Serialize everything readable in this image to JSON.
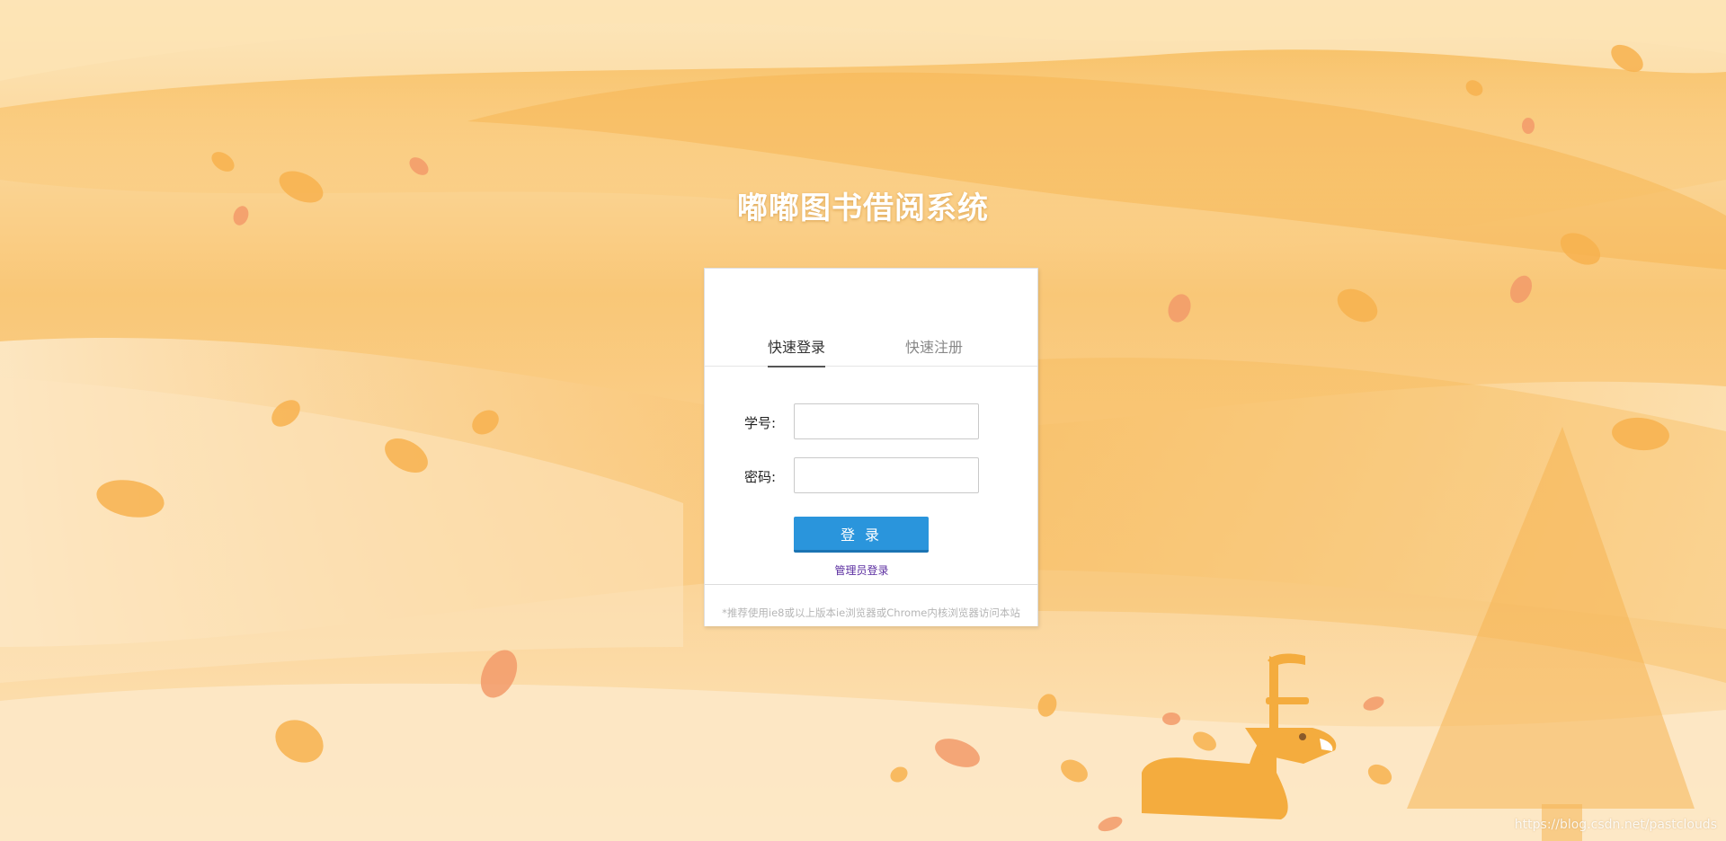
{
  "site": {
    "title": "嘟嘟图书借阅系统"
  },
  "login_card": {
    "tabs": [
      {
        "label": "快速登录",
        "active": true
      },
      {
        "label": "快速注册",
        "active": false
      }
    ],
    "student_id_label": "学号:",
    "student_id_value": "",
    "password_label": "密码:",
    "password_value": "",
    "login_button": "登 录",
    "admin_link": "管理员登录",
    "footer_note": "*推荐使用ie8或以上版本ie浏览器或Chrome内核浏览器访问本站"
  },
  "watermark": "https://blog.csdn.net/pastclouds",
  "colors": {
    "background": "#f9c777",
    "button": "#2a95dc",
    "admin_link": "#5b2ea0"
  },
  "icons": {
    "illustration": "autumn-hills-deer-tree-leaves"
  }
}
